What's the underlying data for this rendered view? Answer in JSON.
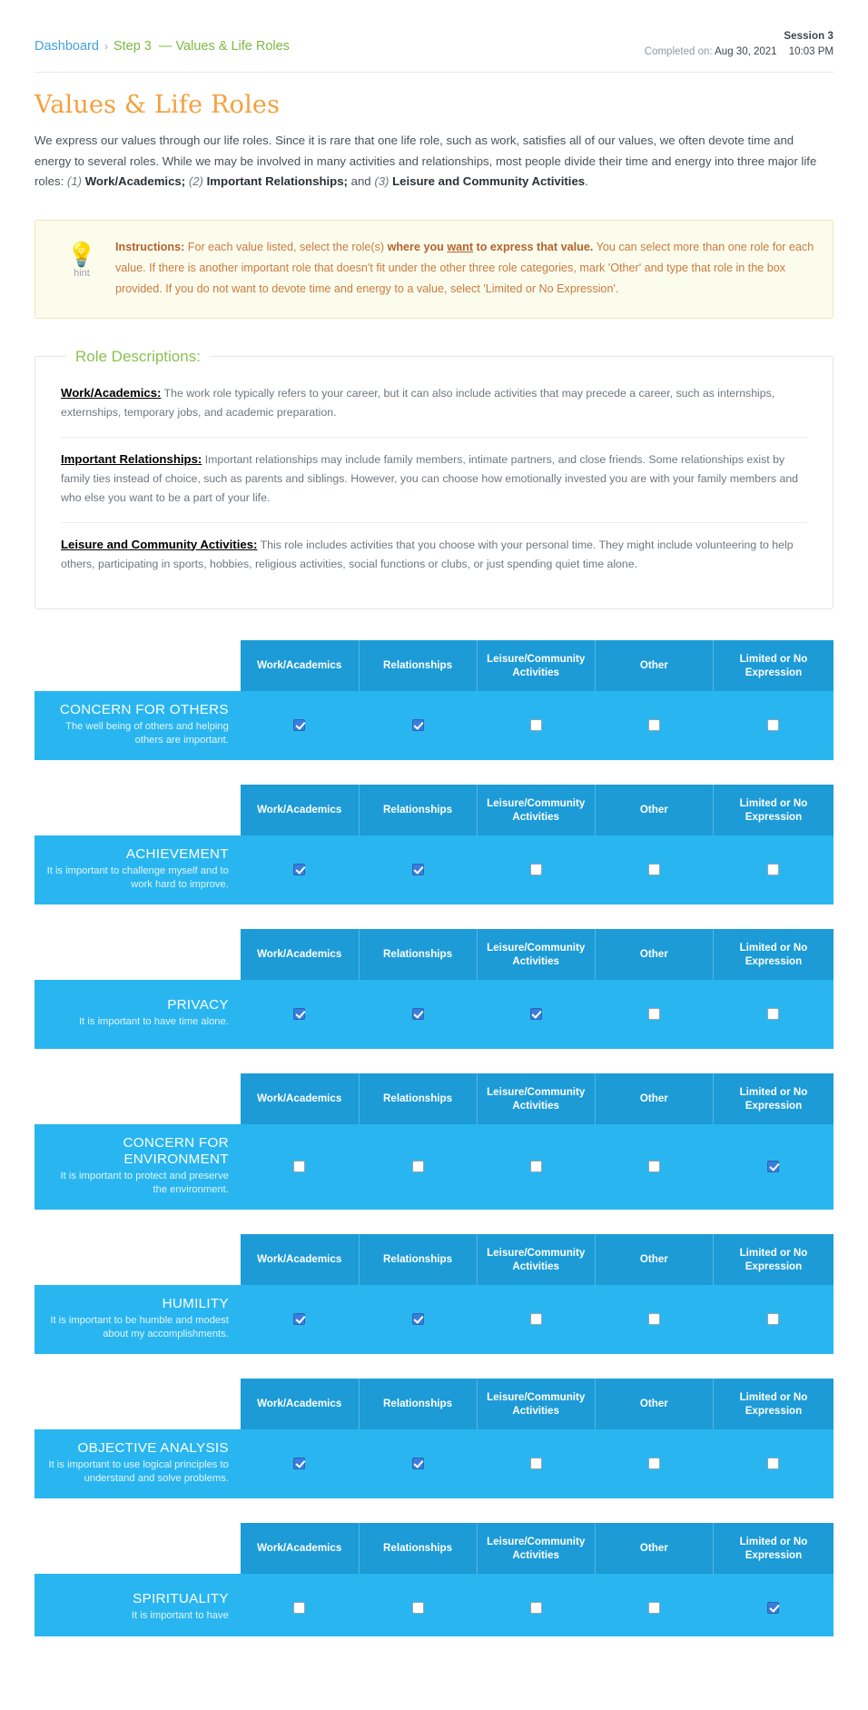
{
  "breadcrumb": {
    "dashboard": "Dashboard",
    "separator": "›",
    "step": "Step 3",
    "tail": "— Values & Life Roles"
  },
  "session": {
    "title": "Session 3",
    "completed_label": "Completed on:",
    "completed_date": "Aug 30, 2021",
    "completed_time": "10:03 PM"
  },
  "page": {
    "title": "Values & Life Roles",
    "intro_1": "We express our values through our life roles. Since it is rare that one life role, such as work, satisfies all of our values, we often devote time and energy to several roles. While we may be involved in many activities and relationships, most people divide their time and energy into three major life roles: ",
    "intro_n1": "(1)",
    "intro_b1": "Work/Academics;",
    "intro_n2": "(2)",
    "intro_b2": "Important Relationships;",
    "intro_and": "and",
    "intro_n3": "(3)",
    "intro_b3": "Leisure and Community Activities",
    "intro_end": "."
  },
  "hint": {
    "icon": "lightbulb-icon",
    "word": "hint",
    "label": "Instructions:",
    "t1": " For each value listed, select the role(s) ",
    "b1": "where you ",
    "u1": "want",
    "b2": " to express that value.",
    "t2": " You can select more than one role for each value. If there is another important role that doesn't fit under the other three role categories, mark 'Other' and type that role in the box provided. If you do not want to devote time and energy to a value, select 'Limited or No Expression'."
  },
  "roles": {
    "legend": "Role Descriptions:",
    "items": [
      {
        "head": "Work/Academics:",
        "body": " The work role typically refers to your career, but it can also include activities that may precede a career, such as internships, externships, temporary jobs, and academic preparation."
      },
      {
        "head": "Important Relationships:",
        "body": " Important relationships may include family members, intimate partners, and close friends. Some relationships exist by family ties instead of choice, such as parents and siblings. However, you can choose how emotionally invested you are with your family members and who else you want to be a part of your life."
      },
      {
        "head": "Leisure and Community Activities:",
        "body": " This role includes activities that you choose with your personal time. They might include volunteering to help others, participating in sports, hobbies, religious activities, social functions or clubs, or just spending quiet time alone."
      }
    ]
  },
  "table": {
    "columns": [
      "Work/Academics",
      "Relationships",
      "Leisure/Community Activities",
      "Other",
      "Limited or No Expression"
    ]
  },
  "values": [
    {
      "name": "CONCERN FOR OTHERS",
      "desc": "The well being of others and helping others are important.",
      "checks": [
        true,
        true,
        false,
        false,
        false
      ]
    },
    {
      "name": "ACHIEVEMENT",
      "desc": "It is important to challenge myself and to work hard to improve.",
      "checks": [
        true,
        true,
        false,
        false,
        false
      ]
    },
    {
      "name": "PRIVACY",
      "desc": "It is important to have time alone.",
      "checks": [
        true,
        true,
        true,
        false,
        false
      ]
    },
    {
      "name": "CONCERN FOR ENVIRONMENT",
      "desc": "It is important to protect and preserve the environment.",
      "checks": [
        false,
        false,
        false,
        false,
        true
      ]
    },
    {
      "name": "HUMILITY",
      "desc": "It is important to be humble and modest about my accomplishments.",
      "checks": [
        true,
        true,
        false,
        false,
        false
      ]
    },
    {
      "name": "OBJECTIVE ANALYSIS",
      "desc": "It is important to use logical principles to understand and solve problems.",
      "checks": [
        true,
        true,
        false,
        false,
        false
      ]
    },
    {
      "name": "SPIRITUALITY",
      "desc": "It is important to have",
      "checks": [
        false,
        false,
        false,
        false,
        true
      ]
    }
  ],
  "colors": {
    "accent_orange": "#f5a03c",
    "green": "#8cc152",
    "link_blue": "#44a3dd",
    "header_blue": "#1c9bd7",
    "row_blue": "#29b6f0",
    "hint_bg": "#fcfced"
  }
}
